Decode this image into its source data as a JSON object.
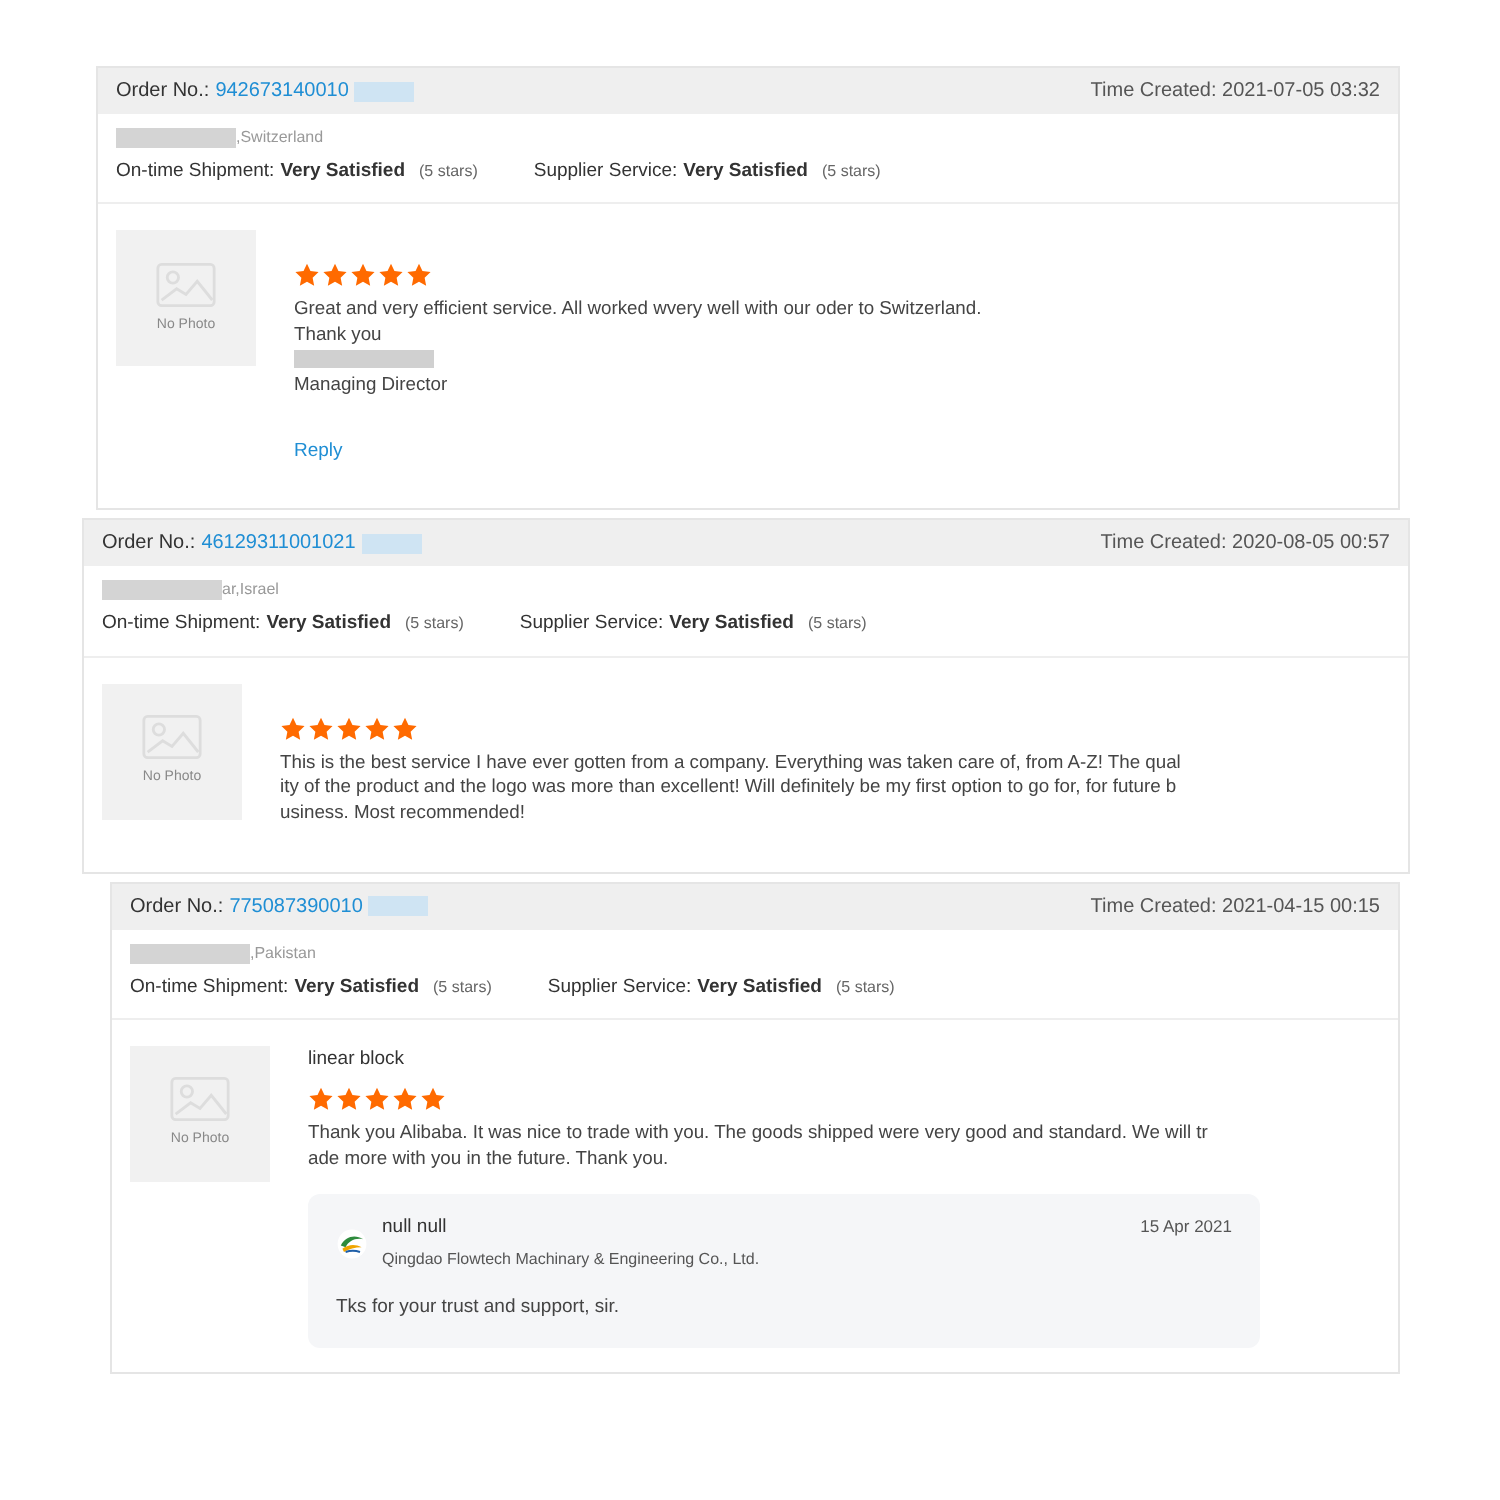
{
  "reviews": [
    {
      "order_label": "Order No.:",
      "order_no": "942673140010",
      "time_created": "Time Created: 2021-07-05 03:32",
      "buyer_location": ",Switzerland",
      "shipment_label": "On-time Shipment:",
      "shipment_rating": "Very Satisfied",
      "shipment_stars": "(5 stars)",
      "service_label": "Supplier Service:",
      "service_rating": "Very Satisfied",
      "service_stars": "(5 stars)",
      "photo_label": "No Photo",
      "stars": 5,
      "comment_lines": [
        {
          "kind": "text",
          "text": "Great and very efficient service. All worked wvery well with our oder to Switzerland."
        },
        {
          "kind": "text",
          "text": "Thank you"
        },
        {
          "kind": "redacted"
        },
        {
          "kind": "text",
          "text": "Managing Director"
        }
      ],
      "reply_link": "Reply"
    },
    {
      "order_label": "Order No.:",
      "order_no": "46129311001021",
      "time_created": "Time Created: 2020-08-05 00:57",
      "buyer_location": "ar,Israel",
      "shipment_label": "On-time Shipment:",
      "shipment_rating": "Very Satisfied",
      "shipment_stars": "(5 stars)",
      "service_label": "Supplier Service:",
      "service_rating": "Very Satisfied",
      "service_stars": "(5 stars)",
      "photo_label": "No Photo",
      "stars": 5,
      "comment_lines": [
        {
          "kind": "text",
          "text": "This is the best service I have ever gotten from a company. Everything was taken care of, from A-Z! The quality of the product and the logo was more than excellent! Will definitely be my first option to go for, for future business. Most recommended!"
        }
      ]
    },
    {
      "order_label": "Order No.:",
      "order_no": "775087390010",
      "time_created": "Time Created: 2021-04-15 00:15",
      "buyer_location": ",Pakistan",
      "shipment_label": "On-time Shipment:",
      "shipment_rating": "Very Satisfied",
      "shipment_stars": "(5 stars)",
      "service_label": "Supplier Service:",
      "service_rating": "Very Satisfied",
      "service_stars": "(5 stars)",
      "photo_label": "No Photo",
      "reviewer": "linear block",
      "stars": 5,
      "comment_lines": [
        {
          "kind": "text",
          "text": "Thank you Alibaba. It was nice to trade with you. The goods shipped were very good and standard. We will trade more with you in the future. Thank you."
        }
      ],
      "supplier_reply": {
        "name": "null null",
        "company": "Qingdao Flowtech Machinary & Engineering Co., Ltd.",
        "date": "15 Apr 2021",
        "text": "Tks for your trust and support, sir."
      }
    }
  ]
}
